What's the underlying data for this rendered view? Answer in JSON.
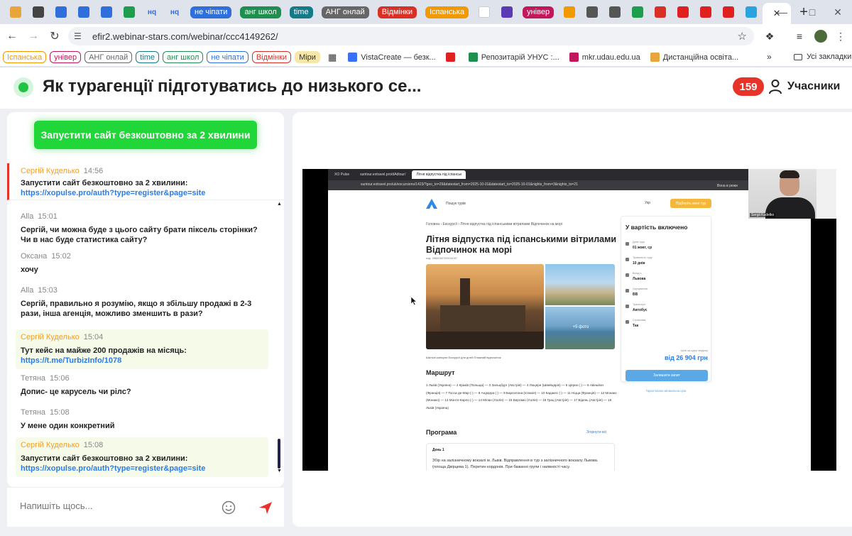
{
  "tabs": {
    "items": [
      {
        "type": "icon",
        "icon": "gift-icon",
        "color": "#e7a53b"
      },
      {
        "type": "icon",
        "icon": "apps-icon",
        "color": "#444444"
      },
      {
        "type": "icon",
        "icon": "planner-icon",
        "color": "#2f6fdc"
      },
      {
        "type": "icon",
        "icon": "docs-icon",
        "color": "#2f6fdc"
      },
      {
        "type": "icon",
        "icon": "planner-icon",
        "color": "#2f6fdc"
      },
      {
        "type": "icon",
        "icon": "sheets-icon",
        "color": "#1e9e4d"
      },
      {
        "type": "text",
        "label": "нq",
        "color": "#2f6fdc"
      },
      {
        "type": "text",
        "label": "нq",
        "color": "#2f6fdc"
      },
      {
        "type": "pill",
        "label": "не чіпати",
        "color": "#2f6fdc"
      },
      {
        "type": "pill",
        "label": "анг школ",
        "color": "#1e8f4f"
      },
      {
        "type": "pill",
        "label": "time",
        "color": "#147a8a"
      },
      {
        "type": "pill",
        "label": "АНГ онлай",
        "color": "#666666"
      },
      {
        "type": "pill",
        "label": "Відмінки",
        "color": "#d93025"
      },
      {
        "type": "pill",
        "label": "Іспанська",
        "color": "#f29900"
      },
      {
        "type": "icon",
        "icon": "google-icon",
        "color": "#ffffff"
      },
      {
        "type": "icon",
        "icon": "app-icon",
        "color": "#5b3bb5"
      },
      {
        "type": "pill",
        "label": "універ",
        "color": "#c2185b"
      },
      {
        "type": "icon",
        "icon": "puzzle-color-icon",
        "color": "#f29900"
      },
      {
        "type": "icon",
        "icon": "hat-icon",
        "color": "#555555"
      },
      {
        "type": "icon",
        "icon": "hat-icon",
        "color": "#555555"
      },
      {
        "type": "icon",
        "icon": "sheets-icon",
        "color": "#1e9e4d"
      },
      {
        "type": "icon",
        "icon": "pdf-icon",
        "color": "#d93025"
      },
      {
        "type": "icon",
        "icon": "youtube-icon",
        "color": "#e02020"
      },
      {
        "type": "icon",
        "icon": "pinterest-icon",
        "color": "#e02020"
      },
      {
        "type": "icon",
        "icon": "pinterest-icon",
        "color": "#e02020"
      },
      {
        "type": "icon",
        "icon": "telegram-icon",
        "color": "#2aa3df"
      }
    ]
  },
  "toolbar": {
    "url": "efir2.webinar-stars.com/webinar/ccc4149262/"
  },
  "bookmarks": {
    "pills": [
      {
        "label": "Іспанська",
        "color": "#f29900"
      },
      {
        "label": "універ",
        "color": "#c2185b"
      },
      {
        "label": "АНГ онлай",
        "color": "#666666"
      },
      {
        "label": "time",
        "color": "#147a8a"
      },
      {
        "label": "анг школ",
        "color": "#1e8f4f"
      },
      {
        "label": "не чіпати",
        "color": "#2f6fdc"
      },
      {
        "label": "Відмінки",
        "color": "#d93025"
      },
      {
        "label": "Міри",
        "color": "#f7e7a8"
      }
    ],
    "links": [
      {
        "label": "VistaCreate — безк...",
        "color": "#3a6ff7"
      },
      {
        "label": "",
        "color": "#e02020"
      },
      {
        "label": "Репозитарій УНУС :...",
        "color": "#1e8f4f"
      },
      {
        "label": "mkr.udau.edu.ua",
        "color": "#c2185b"
      },
      {
        "label": "Дистанційна освіта...",
        "color": "#e7a53b"
      }
    ],
    "all_label": "Усі закладки"
  },
  "header": {
    "title": "Як турагенції підготуватись до низького се...",
    "participants_count": "159",
    "participants_label": "Учасники"
  },
  "chat": {
    "cta_label": "Запустити сайт безкоштовно за 2 хвилини",
    "pinned": {
      "author": "Сергій Куделько",
      "time": "14:56",
      "text": "Запустити сайт безкоштовно за 2 хвилини:",
      "link": "https://xopulse.pro/auth?type=register&page=site"
    },
    "messages": [
      {
        "author": "Alla",
        "time": "15:01",
        "text": "Сергій, чи можна буде з цього сайту брати піксель сторінки? Чи в нас буде статистика сайту?",
        "link": "",
        "host": false
      },
      {
        "author": "Оксана",
        "time": "15:02",
        "text": "хочу",
        "link": "",
        "host": false
      },
      {
        "author": "Alla",
        "time": "15:03",
        "text": "Сергій, правильно я розумію, якщо я збільшу продажі в 2-3 рази, інша агенція, можливо зменшить в рази?",
        "link": "",
        "host": false
      },
      {
        "author": "Сергій Куделько",
        "time": "15:04",
        "text": "Тут кейс на майже 200 продажів на місяць:",
        "link": "https://t.me/TurbizInfo/1078",
        "host": true
      },
      {
        "author": "Тетяна",
        "time": "15:06",
        "text": "Допис- це карусель чи рілс?",
        "link": "",
        "host": false
      },
      {
        "author": "Тетяна",
        "time": "15:08",
        "text": "У мене один конкретний",
        "link": "",
        "host": false
      },
      {
        "author": "Сергій Куделько",
        "time": "15:08",
        "text": "Запустити сайт безкоштовно за 2 хвилини:",
        "link": "https://xopulse.pro/auth?type=register&page=site",
        "host": true
      }
    ],
    "input_placeholder": "Напишіть щось..."
  },
  "share": {
    "tabs": [
      "XO Pulse",
      "suntour.extravel.pro/dAdtour/",
      "Літня відпустка під іспанськ"
    ],
    "address": "suntour.extravel.pro/uk/excursions/1423/?geo_to=29&datestart_from=2025-10-01&datestart_to=2025-10-01&nights_from=3&nights_to=21",
    "search_label": "Пошук турів",
    "lang_label": "Укр",
    "cta_label": "Підберіть мені тур",
    "breadcrumbs": "Головна  ›  Екскурсії  ›  Літня відпустка під іспанськими вітрилами Відпочинок на морі",
    "title": "Літня відпустка під іспанськими вітрилами Відпочинок на морі",
    "code": "код: 3684050769314097",
    "more_photos": "+5 фото",
    "tags": "Шкільні канікули     Екскурсії для дітей     Пляжний відпочинок",
    "route_heading": "Маршрут",
    "route": "1 Львів (Україна) — 2 Краків (Польща) — 3 Зальцбург (Австрія) — 4 Люцерн (Швейцарія) — 5 Церих (-) — 6 Авіньйон (Франція) — 7 Тосса-де-Мар (-) — 8 Андорра (-) — 9 Барселона (Іспанія) — 10 Кадакес (-) — 11 Ніцца (Франція) — 12 Монако (Монако) — 13 Монте-Карло (-) — 14 Мілан (Італія) — 15 Бергамо (Італія) — 16 Грац (Австрія) — 17 Відень (Австрія) — 18 Львів (Україна)",
    "program_heading": "Програма",
    "expand_label": "Згорнути всі",
    "day_title": "День 1",
    "day_text": "Збір на залізничному вокзалі м. Львів. Відправлення в тур з залізничного вокзалу Львова. (площа Двірцева 1). Перетин кордонів. При бажанні групи і наявності часу.",
    "included_heading": "У вартість включено",
    "included": [
      {
        "k": "Дата туру",
        "v": "01 жовт, ср"
      },
      {
        "k": "Тривалість туру",
        "v": "10 днів"
      },
      {
        "k": "Виїзд з",
        "v": "Львова"
      },
      {
        "k": "Харчування",
        "v": "BB"
      },
      {
        "k": "Транспорт",
        "v": "Автобус"
      },
      {
        "k": "Страховка",
        "v": "Так"
      }
    ],
    "price_label": "Ціна за одну людину",
    "price": "від 26 904 грн",
    "book_label": "Залишити запит",
    "guarantee": "Гарантована мінімальна ціна",
    "cam_name": "Sergii Kudelko",
    "watermark": "zoom",
    "meta_label": "Вона в режи"
  },
  "colors": {
    "live": "#1fc442",
    "badge": "#e8332a",
    "cta": "#21d639",
    "link": "#2c7be5",
    "host_author": "#f0a030"
  }
}
